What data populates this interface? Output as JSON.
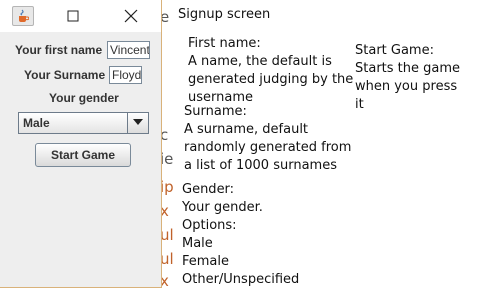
{
  "window": {
    "icon": "java-cup-icon",
    "maximize_icon": "maximize-icon",
    "close_icon": "close-icon"
  },
  "form": {
    "first_name_label": "Your first name",
    "first_name_value": "Vincent",
    "surname_label": "Your Surname",
    "surname_value": "Floyd",
    "gender_label": "Your gender",
    "gender_selected": "Male",
    "start_button": "Start Game"
  },
  "background_chars": [
    "e",
    "c",
    "ie",
    "ip",
    "x",
    "ul",
    "ul",
    "x"
  ],
  "annotations": {
    "title": "Signup screen",
    "first_name": [
      "First name:",
      "A name, the default is",
      "generated judging by the",
      "username"
    ],
    "surname": [
      "Surname:",
      "A surname, default",
      "randomly generated from",
      "a list of 1000 surnames"
    ],
    "gender": [
      "Gender:",
      "Your gender.",
      "Options:",
      "Male",
      "Female",
      "Other/Unspecified"
    ],
    "start_game": [
      "Start Game:",
      "Starts the game",
      "when you press",
      "it"
    ]
  }
}
